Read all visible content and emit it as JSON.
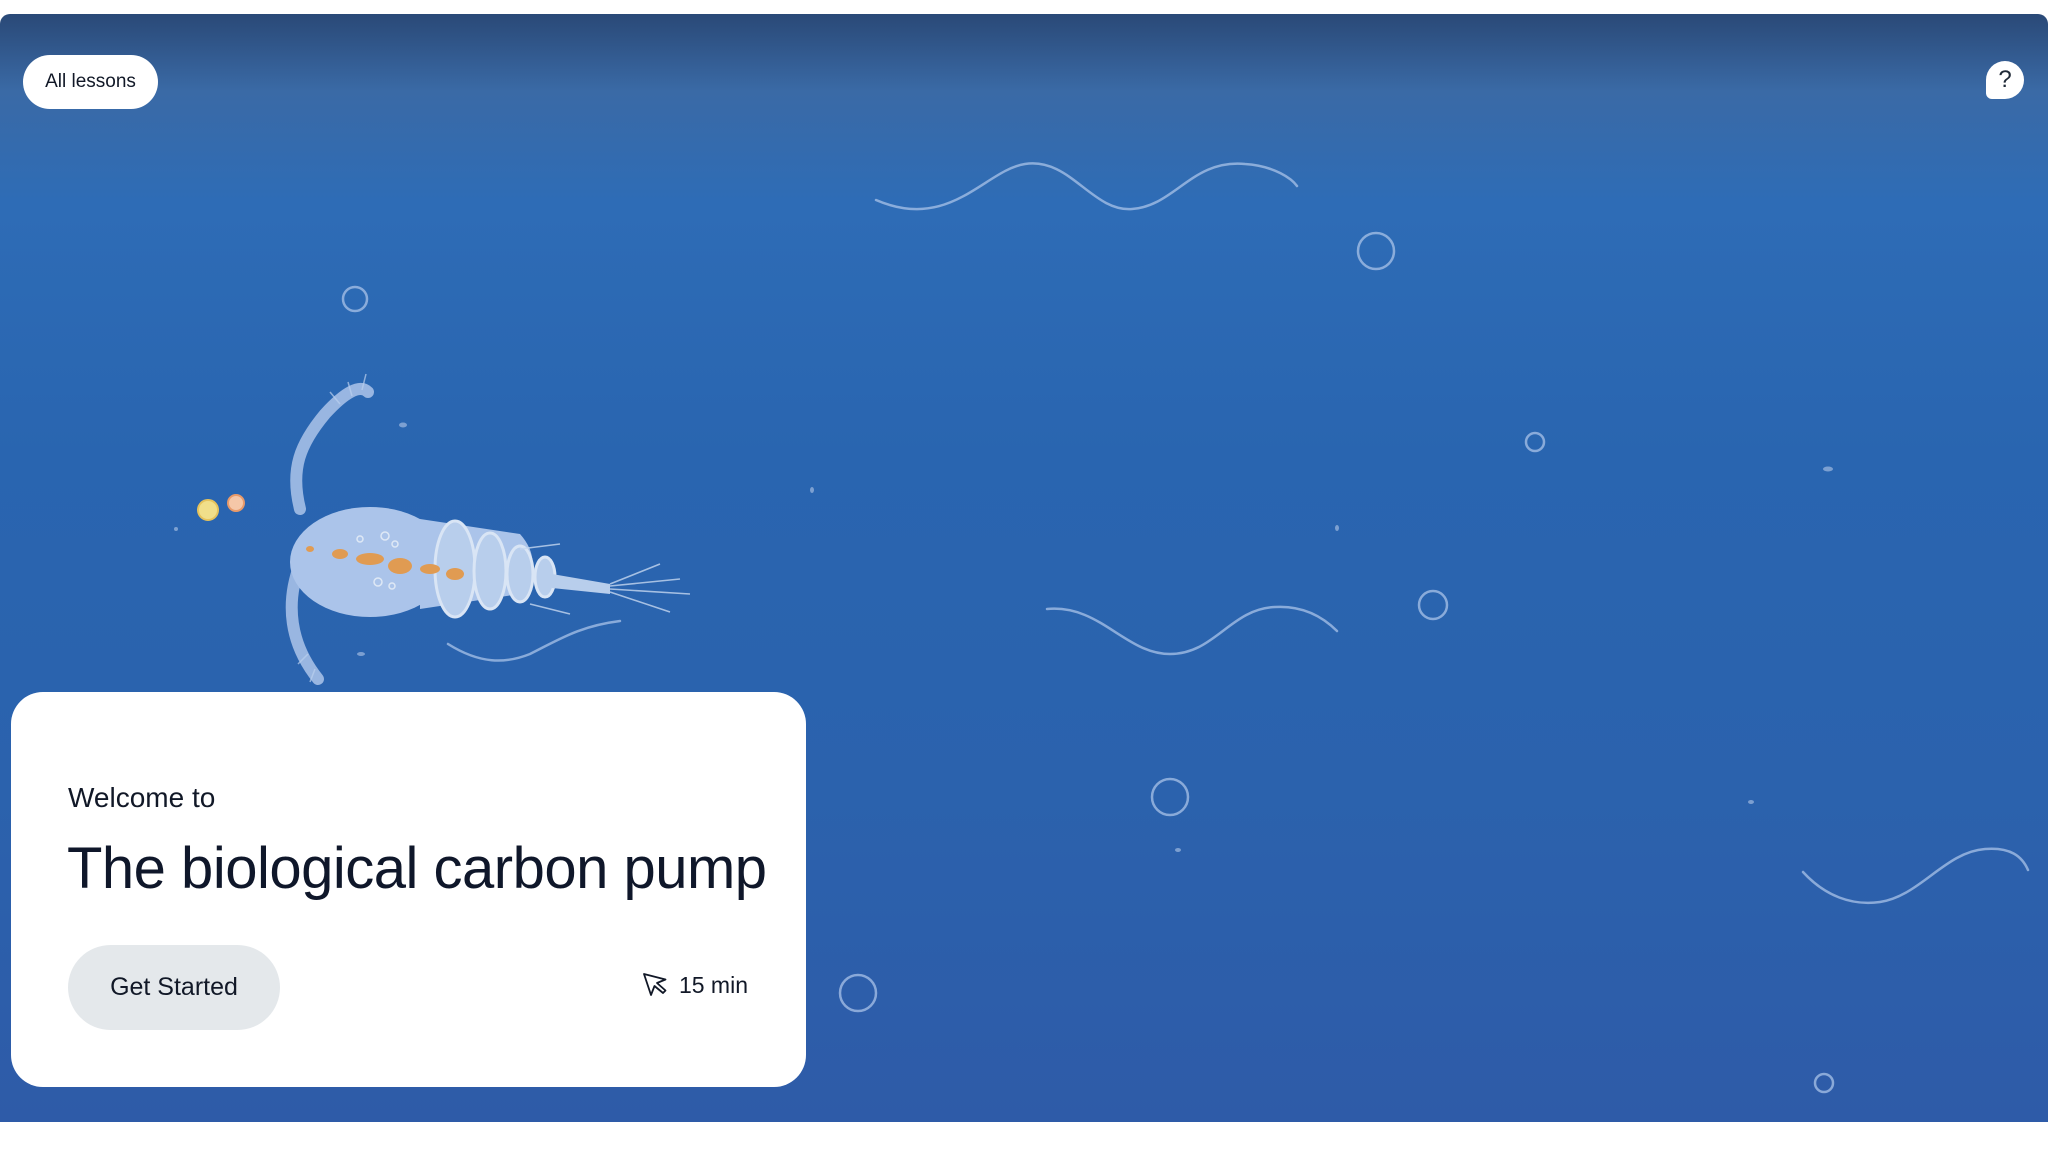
{
  "nav": {
    "all_lessons_label": "All lessons",
    "help_label": "?"
  },
  "lesson": {
    "eyebrow": "Welcome to",
    "title": "The biological carbon pump",
    "cta_label": "Get Started",
    "duration": "15 min"
  },
  "icons": {
    "help": "help-bubble-icon",
    "duration": "cursor-pointer-icon"
  },
  "colors": {
    "ocean_top": "#2a4977",
    "ocean_mid": "#2965b0",
    "ocean_bottom": "#2e5ba8",
    "card": "#ffffff",
    "cta_background": "#e4e8eb",
    "copepod_body": "#b7cdef",
    "copepod_gut": "#f0a04b"
  }
}
